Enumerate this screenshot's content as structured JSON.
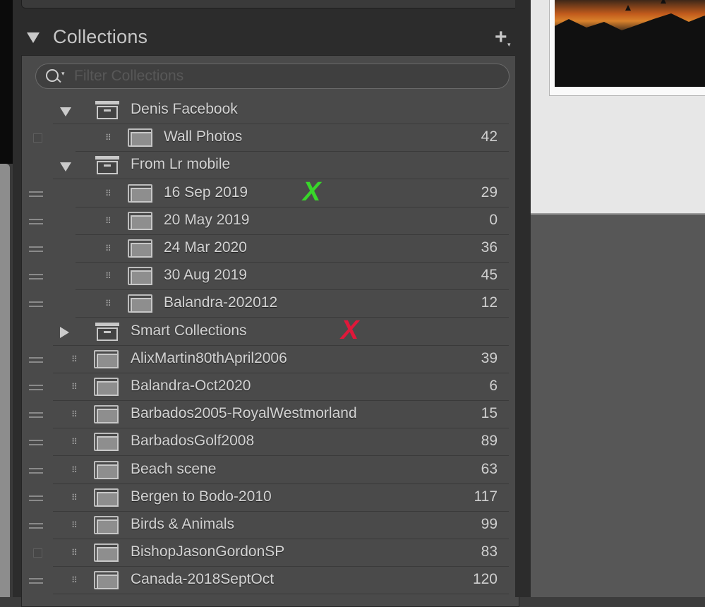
{
  "panel": {
    "title": "Collections",
    "add_label": "+",
    "add_caret": "▾",
    "search_placeholder": "Filter Collections"
  },
  "rows": [
    {
      "type": "set",
      "label": "Denis Facebook",
      "indent": 1,
      "expanded": true,
      "left": "none",
      "count": ""
    },
    {
      "type": "collection",
      "label": "Wall Photos",
      "indent": 2,
      "left": "checkbox",
      "count": "42"
    },
    {
      "type": "set",
      "label": "From Lr mobile",
      "indent": 1,
      "expanded": true,
      "left": "none",
      "count": ""
    },
    {
      "type": "collection",
      "label": "16 Sep 2019",
      "indent": 2,
      "left": "sync",
      "count": "29"
    },
    {
      "type": "collection",
      "label": "20 May 2019",
      "indent": 2,
      "left": "sync",
      "count": "0"
    },
    {
      "type": "collection",
      "label": "24 Mar 2020",
      "indent": 2,
      "left": "sync",
      "count": "36"
    },
    {
      "type": "collection",
      "label": "30 Aug 2019",
      "indent": 2,
      "left": "sync",
      "count": "45"
    },
    {
      "type": "collection",
      "label": "Balandra-202012",
      "indent": 2,
      "left": "sync",
      "count": "12"
    },
    {
      "type": "set",
      "label": "Smart Collections",
      "indent": 1,
      "expanded": false,
      "left": "none",
      "count": ""
    },
    {
      "type": "collection",
      "label": "AlixMartin80thApril2006",
      "indent": 1,
      "left": "sync",
      "count": "39"
    },
    {
      "type": "collection",
      "label": "Balandra-Oct2020",
      "indent": 1,
      "left": "sync",
      "count": "6"
    },
    {
      "type": "collection",
      "label": "Barbados2005-RoyalWestmorland",
      "indent": 1,
      "left": "sync",
      "count": "15"
    },
    {
      "type": "collection",
      "label": "BarbadosGolf2008",
      "indent": 1,
      "left": "sync",
      "count": "89"
    },
    {
      "type": "collection",
      "label": "Beach scene",
      "indent": 1,
      "left": "sync",
      "count": "63"
    },
    {
      "type": "collection",
      "label": "Bergen to Bodo-2010",
      "indent": 1,
      "left": "sync",
      "count": "117"
    },
    {
      "type": "collection",
      "label": "Birds & Animals",
      "indent": 1,
      "left": "sync",
      "count": "99"
    },
    {
      "type": "collection",
      "label": "BishopJasonGordonSP",
      "indent": 1,
      "left": "checkbox",
      "count": "83"
    },
    {
      "type": "collection",
      "label": "Canada-2018SeptOct",
      "indent": 1,
      "left": "sync",
      "count": "120"
    }
  ],
  "annotations": [
    {
      "text": "X",
      "color": "#38d62a",
      "row": 3
    },
    {
      "text": "X",
      "color": "#e0183a",
      "row": 8
    }
  ],
  "colors": {
    "panel_bg": "#2c2c2c",
    "list_bg": "#4a4a4a",
    "text": "#d3d3d3",
    "green_mark": "#38d62a",
    "red_mark": "#e0183a"
  }
}
